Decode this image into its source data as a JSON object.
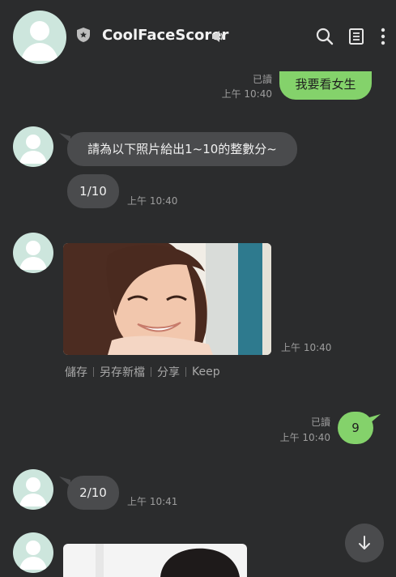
{
  "chat": {
    "name": "CoolFaceScorer"
  },
  "messages": {
    "m1": {
      "text": "我要看女生",
      "read": "已讀",
      "time": "上午 10:40"
    },
    "m2": {
      "text": "請為以下照片給出1~10的整數分~"
    },
    "m3": {
      "text": "1/10",
      "time": "上午 10:40"
    },
    "m4": {
      "time": "上午 10:40"
    },
    "m5": {
      "text": "9",
      "read": "已讀",
      "time": "上午 10:40"
    },
    "m6": {
      "text": "2/10",
      "time": "上午 10:41"
    }
  },
  "image_actions": {
    "save": "儲存",
    "save_as": "另存新檔",
    "share": "分享",
    "keep": "Keep"
  },
  "colors": {
    "background": "#2b2c2d",
    "incoming_bubble": "#4a4b4d",
    "outgoing_bubble": "#84d26b",
    "avatar": "#cde6dd"
  },
  "icons": {
    "header": [
      "shield-icon",
      "speaker-icon",
      "search-icon",
      "notes-icon",
      "more-vert-icon"
    ],
    "scroll": "arrow-down-icon"
  }
}
